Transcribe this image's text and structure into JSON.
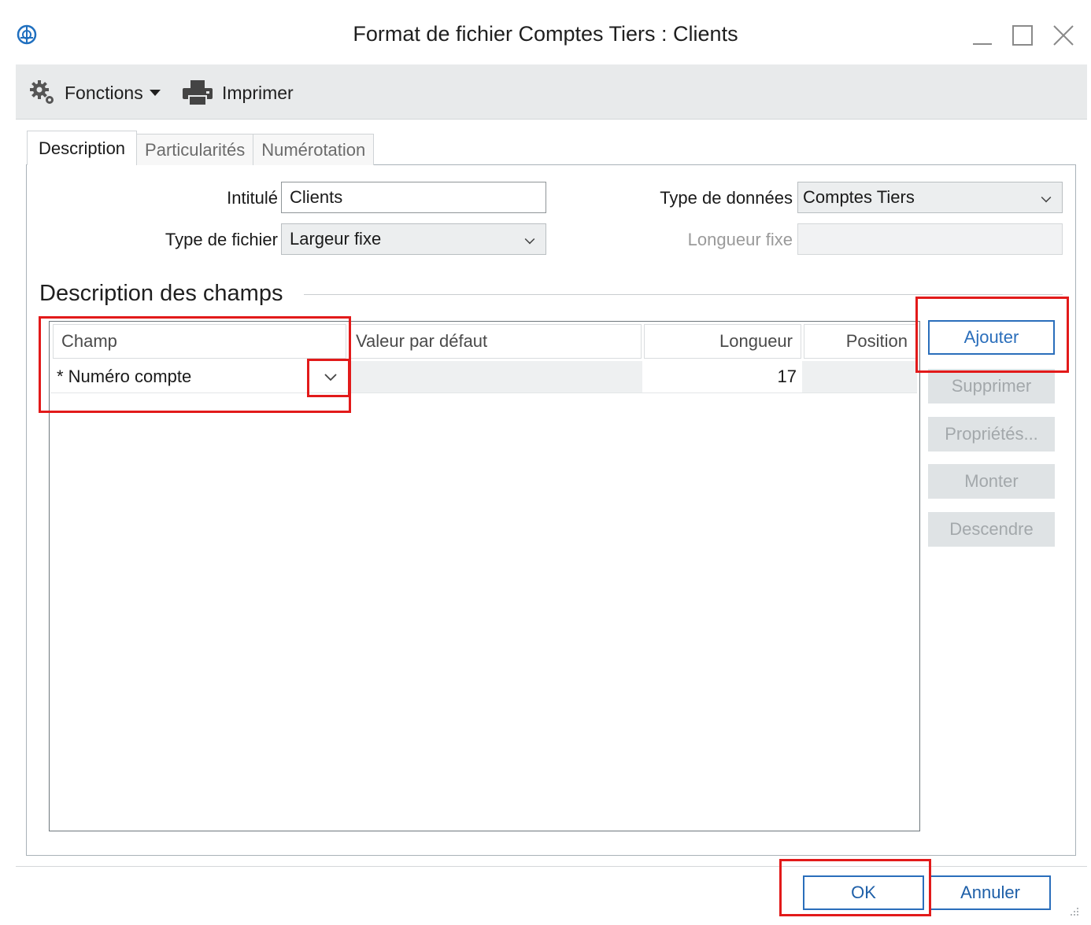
{
  "window": {
    "title": "Format de fichier Comptes Tiers : Clients"
  },
  "toolbar": {
    "functions_label": "Fonctions",
    "print_label": "Imprimer"
  },
  "tabs": [
    {
      "label": "Description",
      "active": true
    },
    {
      "label": "Particularités",
      "active": false
    },
    {
      "label": "Numérotation",
      "active": false
    }
  ],
  "form": {
    "intitule_label": "Intitulé",
    "intitule_value": "Clients",
    "type_fichier_label": "Type de fichier",
    "type_fichier_value": "Largeur fixe",
    "type_donnees_label": "Type de données",
    "type_donnees_value": "Comptes Tiers",
    "longueur_fixe_label": "Longueur fixe",
    "longueur_fixe_value": ""
  },
  "fields_group": {
    "title": "Description des champs",
    "columns": [
      "Champ",
      "Valeur par défaut",
      "Longueur",
      "Position"
    ],
    "rows": [
      {
        "champ": "* Numéro compte",
        "valeur": "",
        "longueur": "17",
        "position": ""
      }
    ]
  },
  "side_buttons": {
    "add": "Ajouter",
    "delete": "Supprimer",
    "properties": "Propriétés...",
    "up": "Monter",
    "down": "Descendre"
  },
  "footer": {
    "ok": "OK",
    "cancel": "Annuler"
  },
  "colors": {
    "accent": "#2a6ebb",
    "highlight": "#e21a1a",
    "toolbar_bg": "#e8eaeb"
  },
  "icons": [
    "app-logo-icon",
    "minimize-icon",
    "maximize-icon",
    "close-icon",
    "gear-icon",
    "printer-icon",
    "chevron-down-icon",
    "resize-grip-icon"
  ]
}
